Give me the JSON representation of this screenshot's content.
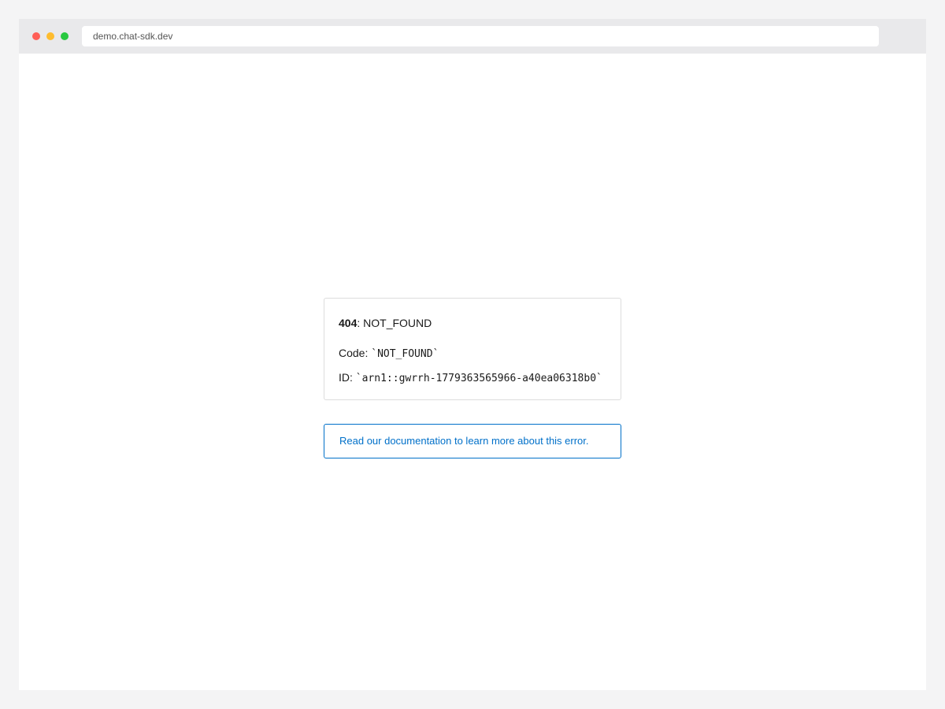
{
  "browser": {
    "url": "demo.chat-sdk.dev",
    "traffic_lights": {
      "close_color": "#ff5f57",
      "minimize_color": "#febc2e",
      "maximize_color": "#28c840"
    }
  },
  "error": {
    "status_code": "404",
    "separator": ": ",
    "status_text": "NOT_FOUND",
    "code_label": "Code: ",
    "code_value": "`NOT_FOUND`",
    "id_label": "ID: ",
    "id_value": "`arn1::gwrrh-1779363565966-a40ea06318b0`"
  },
  "doc_link": {
    "label": "Read our documentation to learn more about this error.",
    "color": "#0070c9"
  }
}
